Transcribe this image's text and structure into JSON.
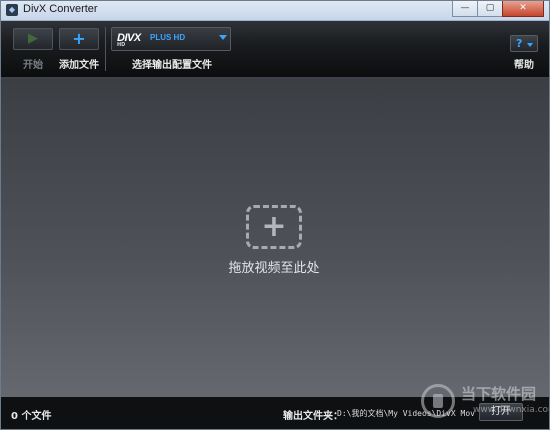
{
  "window": {
    "title": "DivX Converter",
    "controls": {
      "minimize": "—",
      "maximize": "▢",
      "close": "✕"
    }
  },
  "toolbar": {
    "start_label": "开始",
    "add_label": "添加文件",
    "profile": {
      "logo": "DIVX",
      "logo_sub": "HD",
      "name": "PLUS HD",
      "caption": "选择输出配置文件"
    },
    "help_label": "帮助",
    "help_glyph": "?"
  },
  "drop_area": {
    "text": "拖放视频至此处"
  },
  "statusbar": {
    "file_count": "0 个文件",
    "output_label": "输出文件夹：",
    "output_path": "D:\\我的文档\\My Videos\\DivX Movies",
    "open_label": "打开"
  },
  "watermark": {
    "text": "当下软件园",
    "url": "www.downxia.com"
  },
  "colors": {
    "accent": "#3aa5ff",
    "toolbar_bg": "#111214",
    "drop_bg": "#50545a"
  }
}
